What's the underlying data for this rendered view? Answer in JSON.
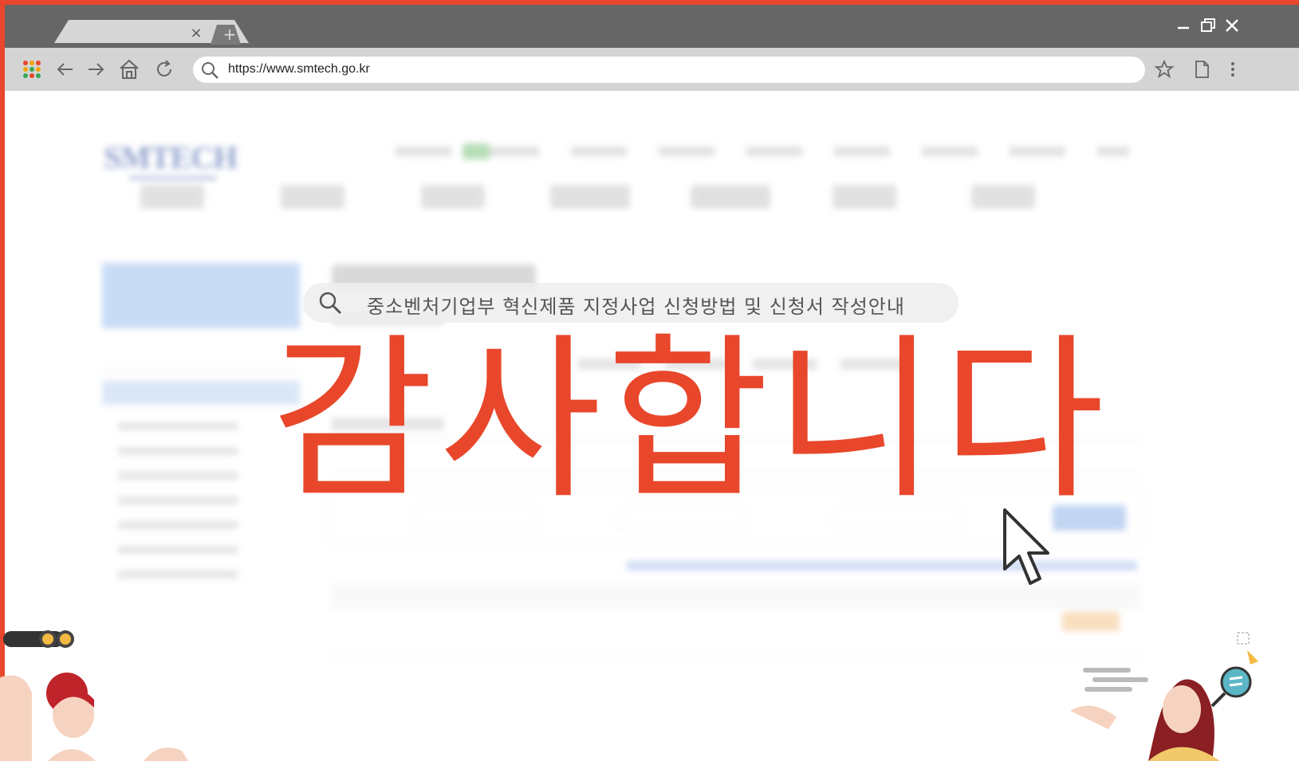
{
  "browser": {
    "tab_close_glyph": "×",
    "new_tab_glyph": "+",
    "address_url": "https://www.smtech.go.kr",
    "icons": [
      "apps-grid-icon",
      "back-arrow-icon",
      "forward-arrow-icon",
      "home-icon",
      "reload-icon",
      "search-icon",
      "star-icon",
      "page-icon",
      "more-vertical-icon"
    ],
    "window_controls": [
      "minimize-icon",
      "restore-icon",
      "close-icon"
    ]
  },
  "page": {
    "logo_text": "SMTECH"
  },
  "overlay": {
    "search_caption": "중소벤처기업부 혁신제품 지정사업 신청방법 및 신청서 작성안내",
    "thanks_text": "감사합니다"
  },
  "colors": {
    "accent": "#e8472b",
    "chrome_dark": "#666666",
    "chrome_light": "#d4d4d4",
    "logo_blue": "#3b59a8"
  }
}
